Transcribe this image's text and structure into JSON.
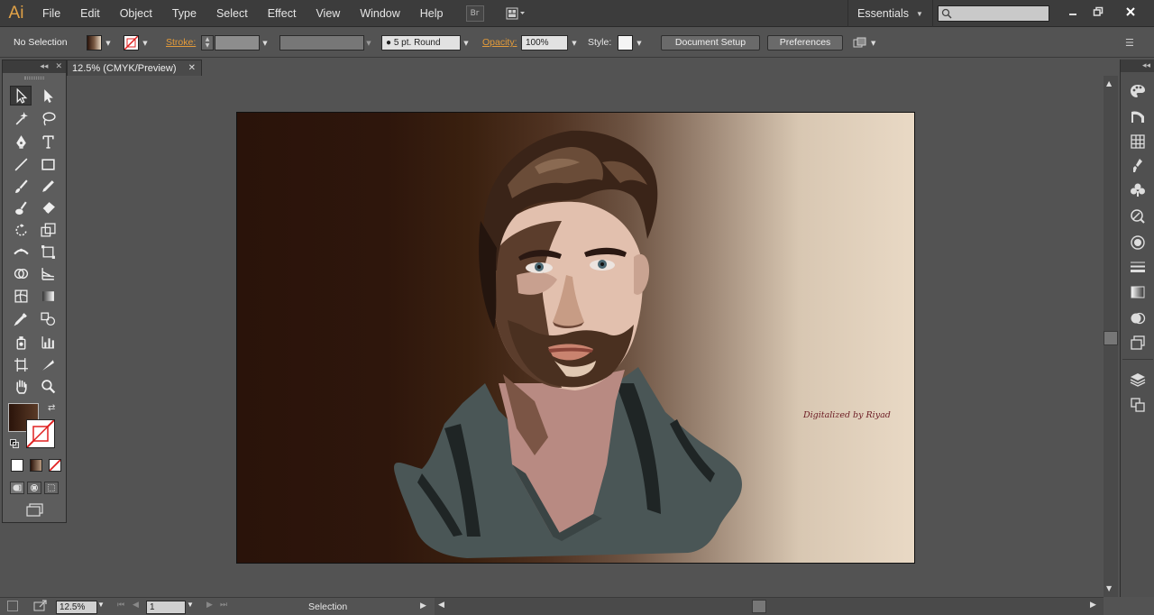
{
  "app": {
    "logo": "Ai",
    "menus": [
      "File",
      "Edit",
      "Object",
      "Type",
      "Select",
      "Effect",
      "View",
      "Window",
      "Help"
    ],
    "workspace": "Essentials",
    "search_placeholder": ""
  },
  "control_bar": {
    "selection_status": "No Selection",
    "stroke_label": "Stroke:",
    "brush_value": "5 pt. Round",
    "opacity_label": "Opacity:",
    "opacity_value": "100%",
    "style_label": "Style:",
    "document_setup_label": "Document Setup",
    "preferences_label": "Preferences"
  },
  "document": {
    "tab_title": "12.5% (CMYK/Preview)",
    "signature_text": "Digitalized by Riyad"
  },
  "status_bar": {
    "zoom": "12.5%",
    "artboard_number": "1",
    "current_tool": "Selection"
  },
  "colors": {
    "accent_orange": "#e39b3a",
    "logo_color": "#e2a347",
    "fill_color": "#2a130a"
  },
  "tools": [
    "selection-tool-icon",
    "direct-selection-tool-icon",
    "magic-wand-tool-icon",
    "lasso-tool-icon",
    "pen-tool-icon",
    "type-tool-icon",
    "line-segment-tool-icon",
    "rectangle-tool-icon",
    "paintbrush-tool-icon",
    "pencil-tool-icon",
    "blob-brush-tool-icon",
    "eraser-tool-icon",
    "rotate-tool-icon",
    "scale-tool-icon",
    "width-tool-icon",
    "free-transform-tool-icon",
    "shape-builder-tool-icon",
    "perspective-grid-tool-icon",
    "mesh-tool-icon",
    "gradient-tool-icon",
    "eyedropper-tool-icon",
    "blend-tool-icon",
    "symbol-sprayer-tool-icon",
    "column-graph-tool-icon",
    "artboard-tool-icon",
    "slice-tool-icon",
    "hand-tool-icon",
    "zoom-tool-icon"
  ],
  "dock_panels": [
    "color-panel-icon",
    "color-guide-icon",
    "swatches-icon",
    "brushes-icon",
    "symbols-icon",
    "graphic-styles-icon",
    "appearance-icon",
    "stroke-icon",
    "gradient-icon",
    "transparency-icon",
    "image-trace-icon",
    "layers-icon",
    "artboards-icon"
  ]
}
